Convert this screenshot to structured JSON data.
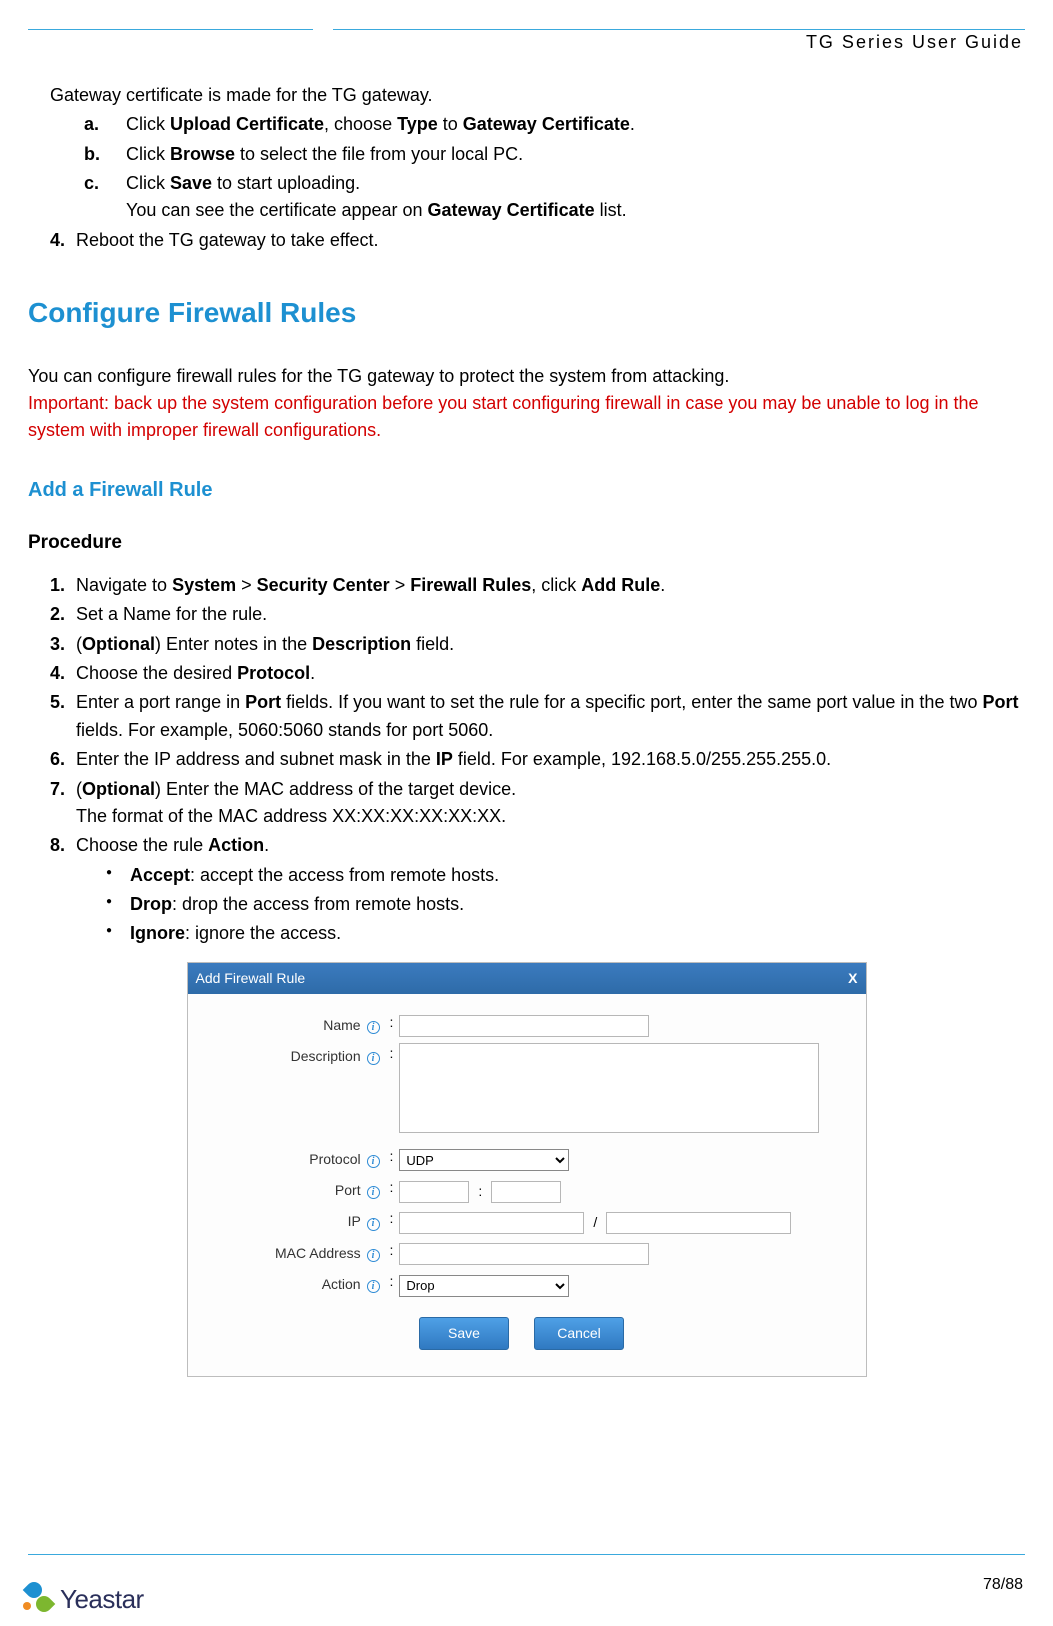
{
  "header": {
    "title": "TG  Series  User  Guide"
  },
  "intro_line": "Gateway certificate is made for the TG gateway.",
  "cert_steps": {
    "a": {
      "prefix": "a.",
      "t1": "Click ",
      "b1": "Upload Certificate",
      "t2": ", choose ",
      "b2": "Type",
      "t3": " to ",
      "b3": "Gateway Certificate",
      "t4": "."
    },
    "b": {
      "prefix": "b.",
      "t1": "Click ",
      "b1": "Browse",
      "t2": " to select the file from your local PC."
    },
    "c": {
      "prefix": "c.",
      "t1": "Click ",
      "b1": "Save",
      "t2": " to start uploading."
    },
    "c2": {
      "t1": "You can see the certificate appear on ",
      "b1": "Gateway Certificate",
      "t2": " list."
    }
  },
  "step4": {
    "prefix": "4.",
    "text": "Reboot the TG gateway to take effect."
  },
  "h2": "Configure Firewall Rules",
  "p1": "You can configure firewall rules for the TG gateway to protect the system from attacking.",
  "important": "Important: back up the system configuration before you start configuring firewall in case you may be unable to log in the system with improper firewall configurations.",
  "h3": "Add a Firewall Rule",
  "h4": "Procedure",
  "proc": {
    "s1": {
      "prefix": "1.",
      "t1": "Navigate to ",
      "b1": "System",
      "t2": " > ",
      "b2": "Security Center",
      "t3": " > ",
      "b3": "Firewall Rules",
      "t4": ", click ",
      "b4": "Add Rule",
      "t5": "."
    },
    "s2": {
      "prefix": "2.",
      "text": "Set a Name for the rule."
    },
    "s3": {
      "prefix": "3.",
      "t1": "(",
      "b1": "Optional",
      "t2": ") Enter notes in the ",
      "b2": "Description",
      "t3": " field."
    },
    "s4": {
      "prefix": "4.",
      "t1": "Choose the desired ",
      "b1": "Protocol",
      "t2": "."
    },
    "s5": {
      "prefix": "5.",
      "t1": "Enter a port range in ",
      "b1": "Port",
      "t2": " fields. If you want to set the rule for a specific port, enter the same port value in the two ",
      "b2": "Port",
      "t3": " fields. For example, 5060:5060 stands for port 5060."
    },
    "s6": {
      "prefix": "6.",
      "t1": "Enter the IP address and subnet mask in the ",
      "b1": "IP",
      "t2": " field. For example, 192.168.5.0/255.255.255.0."
    },
    "s7": {
      "prefix": "7.",
      "t1": "(",
      "b1": "Optional",
      "t2": ") Enter the MAC address of the target device."
    },
    "s7b": "The format of the MAC address XX:XX:XX:XX:XX:XX.",
    "s8": {
      "prefix": "8.",
      "t1": "Choose the rule ",
      "b1": "Action",
      "t2": "."
    }
  },
  "actions": {
    "accept": {
      "b": "Accept",
      "t": ": accept the access from remote hosts."
    },
    "drop": {
      "b": "Drop",
      "t": ": drop the access from remote hosts."
    },
    "ignore": {
      "b": "Ignore",
      "t": ": ignore the access."
    }
  },
  "dialog": {
    "title": "Add Firewall Rule",
    "close": "X",
    "labels": {
      "name": "Name",
      "description": "Description",
      "protocol": "Protocol",
      "port": "Port",
      "ip": "IP",
      "mac": "MAC Address",
      "action": "Action"
    },
    "sep_port": ":",
    "sep_ip": "/",
    "protocol_value": "UDP",
    "action_value": "Drop",
    "save": "Save",
    "cancel": "Cancel"
  },
  "footer": {
    "page": "78/88",
    "logo_text": "Yeastar"
  }
}
